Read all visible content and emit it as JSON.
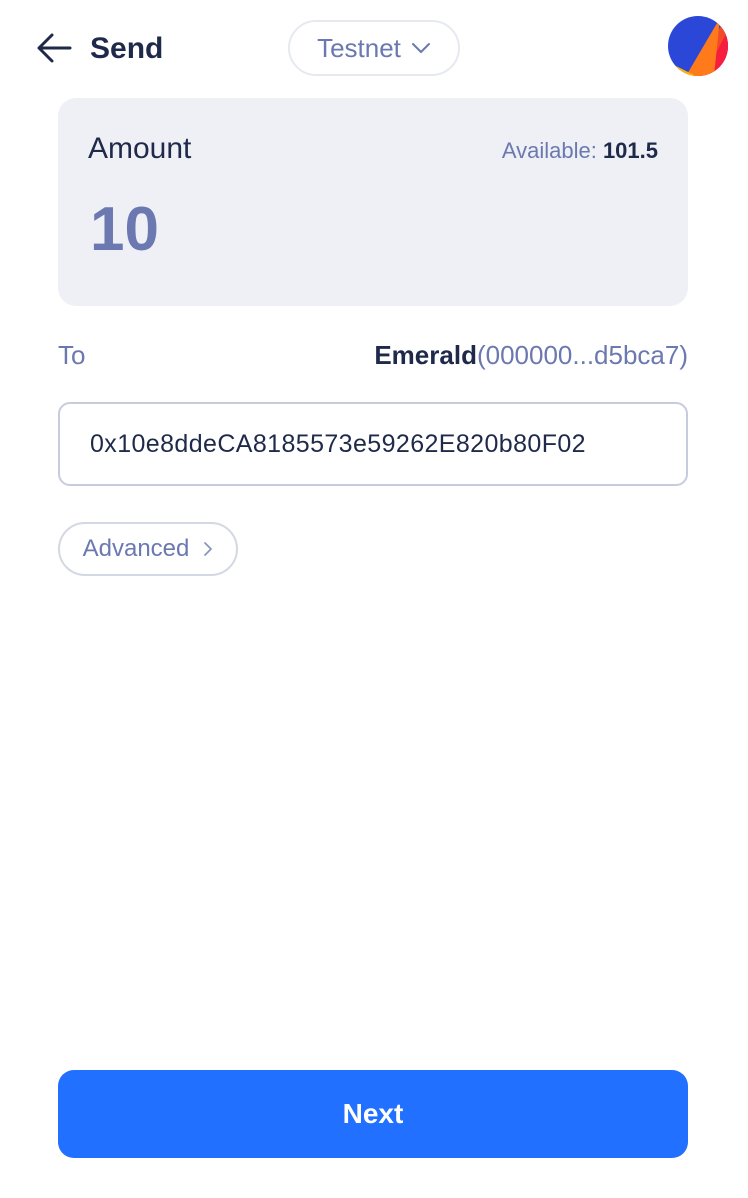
{
  "header": {
    "title": "Send",
    "network": "Testnet"
  },
  "amount_card": {
    "label": "Amount",
    "available_label": "Available:",
    "available_value": "101.5",
    "amount": "10"
  },
  "recipient": {
    "label": "To",
    "account_name": "Emerald",
    "account_address": "(000000...d5bca7)",
    "address_value": "0x10e8ddeCA8185573e59262E820b80F02"
  },
  "advanced": {
    "label": "Advanced"
  },
  "footer": {
    "next_label": "Next"
  },
  "colors": {
    "primary": "#2170ff",
    "text_dark": "#1f2a4a",
    "text_muted": "#6b79b0",
    "card_bg": "#eef0f5"
  },
  "icons": {
    "back": "arrow-left-icon",
    "network_dropdown": "chevron-down-icon",
    "advanced": "chevron-right-icon",
    "avatar": "account-avatar-icon"
  }
}
